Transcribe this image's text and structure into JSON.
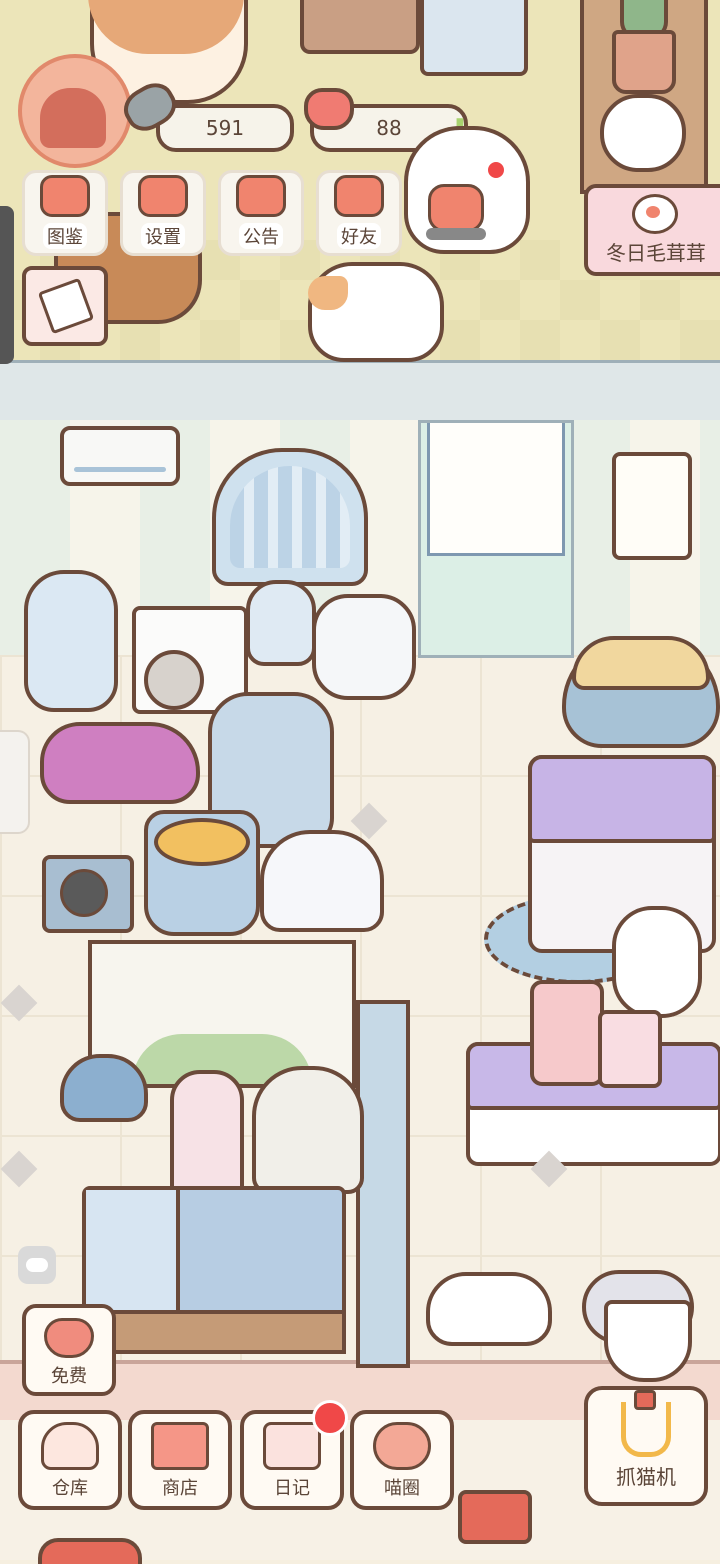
{
  "hud": {
    "fish_currency": "591",
    "heart_currency": "88",
    "add_currency_symbol": "✚"
  },
  "top_menu": {
    "items": [
      {
        "label": "图鉴",
        "icon": "cat-face-icon"
      },
      {
        "label": "设置",
        "icon": "gear-icon"
      },
      {
        "label": "公告",
        "icon": "gift-icon"
      },
      {
        "label": "好友",
        "icon": "friends-icon"
      }
    ]
  },
  "event": {
    "label": "冬日毛茸茸"
  },
  "free": {
    "label": "免费"
  },
  "dock": {
    "items": [
      {
        "label": "仓库",
        "icon": "storage-icon"
      },
      {
        "label": "商店",
        "icon": "shop-icon"
      },
      {
        "label": "日记",
        "icon": "diary-icon"
      },
      {
        "label": "喵圈",
        "icon": "planet-cat-icon"
      }
    ]
  },
  "claw_machine": {
    "label": "抓猫机"
  },
  "colors": {
    "outline": "#6b4a3a",
    "accent_coral": "#f0846e",
    "notification_red": "#f04848",
    "upper_room": "#ece5b9",
    "floor": "#f6f0e4"
  }
}
